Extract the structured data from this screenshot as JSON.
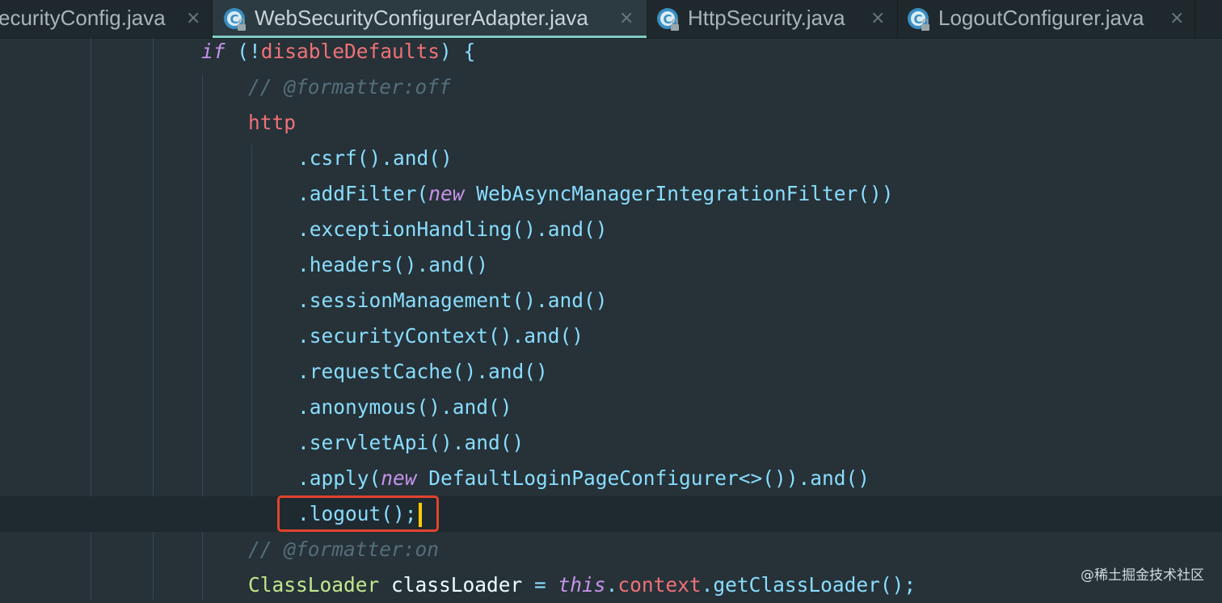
{
  "tabs": [
    {
      "label": "ecurityConfig.java",
      "close": "×",
      "icon": "",
      "active": false
    },
    {
      "label": "WebSecurityConfigurerAdapter.java",
      "close": "×",
      "icon": "java-class-locked-icon",
      "active": true
    },
    {
      "label": "HttpSecurity.java",
      "close": "×",
      "icon": "java-class-locked-icon",
      "active": false
    },
    {
      "label": "LogoutConfigurer.java",
      "close": "×",
      "icon": "java-class-locked-icon",
      "active": false
    }
  ],
  "code": {
    "l1": {
      "kw": "if",
      "rest": " (!",
      "name": "disableDefaults",
      "tail": ") {"
    },
    "l2": {
      "comment": "// @formatter:off"
    },
    "l3": {
      "name": "http"
    },
    "l4": {
      "text": ".csrf().and()"
    },
    "l5": {
      "pre": ".addFilter(",
      "kw": "new",
      "post": " WebAsyncManagerIntegrationFilter())"
    },
    "l6": {
      "text": ".exceptionHandling().and()"
    },
    "l7": {
      "text": ".headers().and()"
    },
    "l8": {
      "text": ".sessionManagement().and()"
    },
    "l9": {
      "text": ".securityContext().and()"
    },
    "l10": {
      "text": ".requestCache().and()"
    },
    "l11": {
      "text": ".anonymous().and()"
    },
    "l12": {
      "text": ".servletApi().and()"
    },
    "l13": {
      "pre": ".apply(",
      "kw": "new",
      "post": " DefaultLoginPageConfigurer<>()).and()"
    },
    "l14": {
      "text": ".logout();"
    },
    "l15": {
      "comment": "// @formatter:on"
    },
    "l16": {
      "type": "ClassLoader",
      "var": " classLoader",
      "op": " = ",
      "kw": "this",
      "dot": ".",
      "field": "context",
      "tail": ".getClassLoader();"
    }
  },
  "watermark": "@稀土掘金技术社区",
  "colors": {
    "background": "#263238",
    "keyword": "#c792ea",
    "method": "#89ddff",
    "field": "#f07178",
    "comment": "#546e7a",
    "type": "#c3e88d",
    "caret": "#ffcc00",
    "highlight_box": "#e3422c",
    "tab_accent": "#80cbc4"
  }
}
